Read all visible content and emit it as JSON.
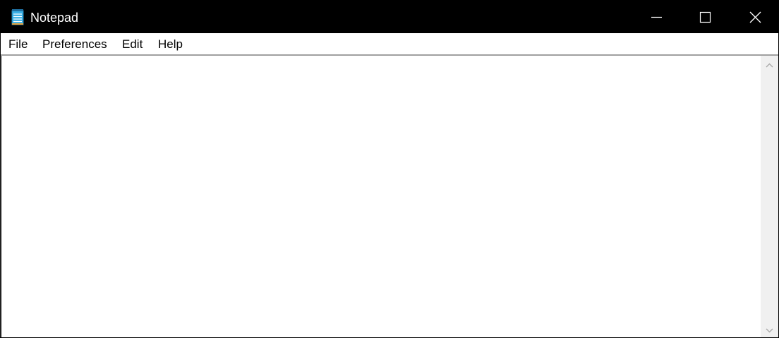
{
  "window": {
    "title": "Notepad",
    "icon": "notepad-icon",
    "controls": {
      "minimize": "minimize-icon",
      "maximize": "maximize-icon",
      "close": "close-icon"
    }
  },
  "menu": {
    "file": "File",
    "preferences": "Preferences",
    "edit": "Edit",
    "help": "Help"
  },
  "editor": {
    "content": ""
  },
  "colors": {
    "titlebar": "#000000",
    "title_text": "#ffffff",
    "menubar": "#ffffff",
    "scrollbar_track": "#f0f0f0",
    "icon_blue": "#3ab0e6"
  }
}
